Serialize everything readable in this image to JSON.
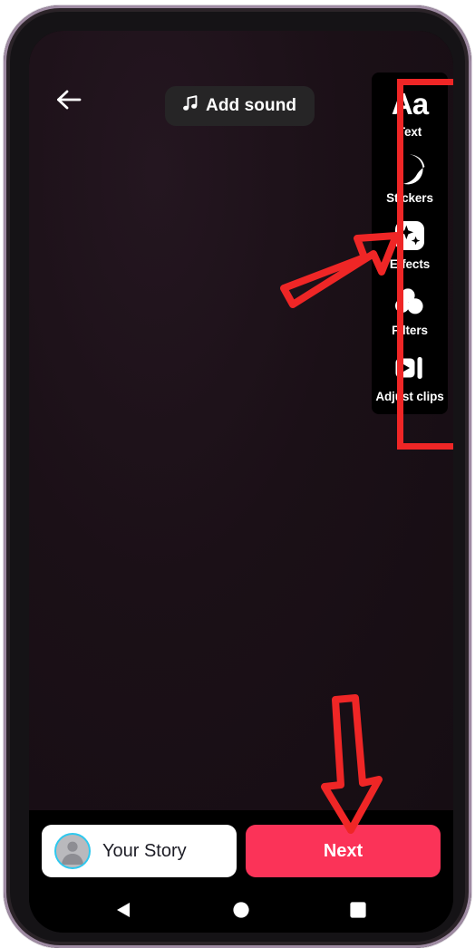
{
  "app": {
    "name": "TikTok Video Editor",
    "screen_background": "#1b1017",
    "accent_color": "#fb3358",
    "annotation_color": "#ef2626"
  },
  "top_bar": {
    "back_icon": "arrow-left-icon",
    "add_sound": {
      "label": "Add sound",
      "icon": "music-note-icon"
    }
  },
  "tool_rail": {
    "items": [
      {
        "label": "Text",
        "icon": "text-aa-icon",
        "glyph": "Aa"
      },
      {
        "label": "Stickers",
        "icon": "sticker-face-icon"
      },
      {
        "label": "Effects",
        "icon": "effects-sparkle-icon"
      },
      {
        "label": "Filters",
        "icon": "filters-circles-icon"
      },
      {
        "label": "Adjust clips",
        "icon": "adjust-clips-icon"
      }
    ]
  },
  "annotations": {
    "highlight_box": {
      "target": "tool-rail",
      "color": "#ef2626"
    },
    "arrows": [
      {
        "name": "arrow-pointing-to-tools",
        "direction": "up-right",
        "color": "#ef2626"
      },
      {
        "name": "arrow-pointing-to-next",
        "direction": "down",
        "color": "#ef2626"
      }
    ]
  },
  "bottom_bar": {
    "your_story": {
      "label": "Your Story",
      "avatar_icon": "user-avatar-placeholder-icon",
      "avatar_ring_color": "#2ec8ee"
    },
    "next": {
      "label": "Next",
      "background": "#fb3358"
    }
  },
  "system_nav": {
    "back_icon": "triangle-back-icon",
    "home_icon": "circle-home-icon",
    "recents_icon": "square-recents-icon"
  }
}
